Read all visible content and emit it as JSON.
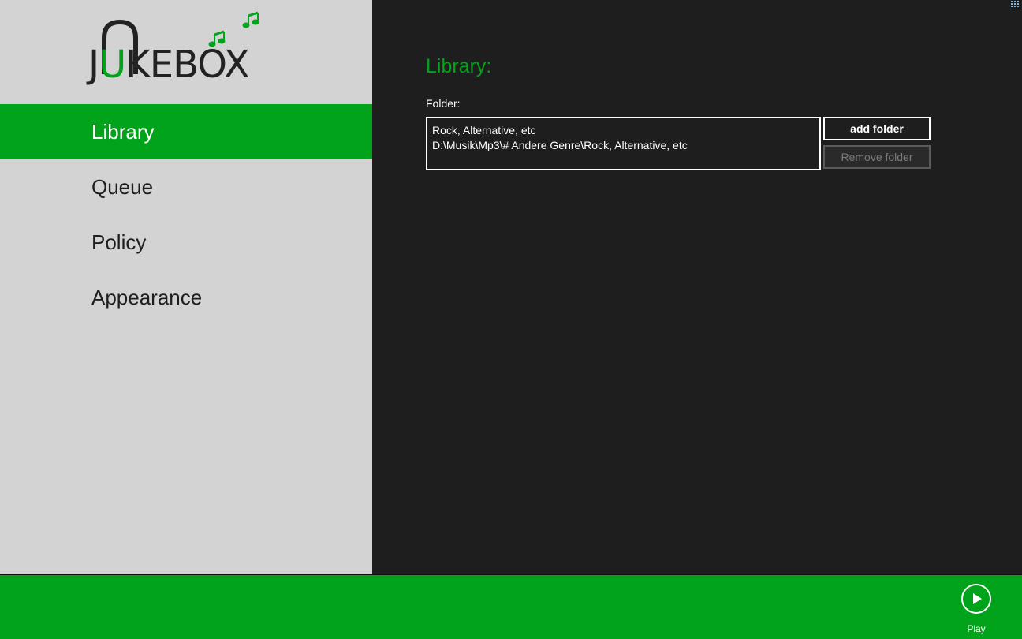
{
  "app": {
    "logo_text_prefix": "J",
    "logo_text_u": "U",
    "logo_text_suffix": "KEBOX",
    "accent_color": "#00a31a",
    "icons": [
      "music-note-icon",
      "play-icon",
      "dots-grid-icon"
    ]
  },
  "sidebar": {
    "items": [
      {
        "label": "Library",
        "active": true
      },
      {
        "label": "Queue",
        "active": false
      },
      {
        "label": "Policy",
        "active": false
      },
      {
        "label": "Appearance",
        "active": false
      }
    ]
  },
  "main": {
    "title": "Library:",
    "folder_label": "Folder:",
    "folders": [
      {
        "name": "Rock, Alternative, etc",
        "path": "D:\\Musik\\Mp3\\# Andere Genre\\Rock, Alternative, etc"
      }
    ],
    "add_folder_label": "add folder",
    "remove_folder_label": "Remove folder"
  },
  "appbar": {
    "play_label": "Play"
  }
}
